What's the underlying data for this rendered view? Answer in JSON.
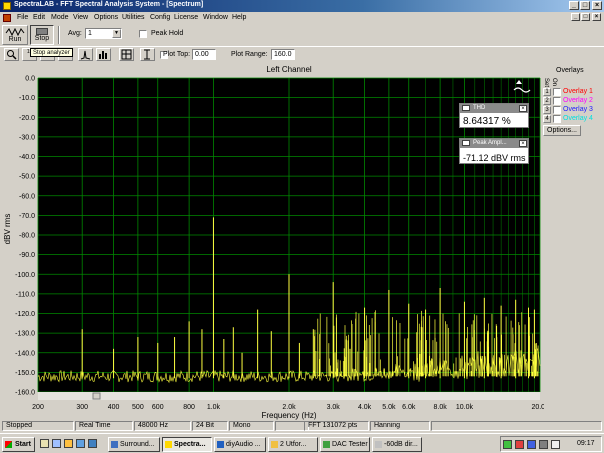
{
  "window": {
    "title": "SpectraLAB - FFT Spectral Analysis System - [Spectrum]"
  },
  "menu": [
    "File",
    "Edit",
    "Mode",
    "View",
    "Options",
    "Utilities",
    "Config",
    "License",
    "Window",
    "Help"
  ],
  "toolbar": {
    "run_label": "Run",
    "stop_label": "Stop",
    "avg_label": "Avg:",
    "avg_value": "1",
    "peak_hold_label": "Peak Hold",
    "tooltip": "Stop analyzer",
    "plot_top_label": "Plot Top:",
    "plot_top_value": "0.00",
    "plot_range_label": "Plot Range:",
    "plot_range_value": "160.0"
  },
  "overlays": {
    "title": "Overlays",
    "set_label": "Set",
    "on_label": "On",
    "items": [
      {
        "num": "1",
        "label": "Overlay 1",
        "color": "#ff0000"
      },
      {
        "num": "2",
        "label": "Overlay 2",
        "color": "#ff00ff"
      },
      {
        "num": "3",
        "label": "Overlay 3",
        "color": "#2020ff"
      },
      {
        "num": "4",
        "label": "Overlay 4",
        "color": "#00e0e0"
      }
    ],
    "options_label": "Options..."
  },
  "readouts": {
    "thd_title": "THD",
    "thd_value": "8.64317 %",
    "peak_title": "Peak Ampl...",
    "peak_value": "-71.12 dBV rms"
  },
  "status": {
    "state": "Stopped",
    "mode": "Real Time",
    "rate": "48000 Hz",
    "bits": "24 Bit",
    "channels": "Mono",
    "fft": "FFT 131072 pts",
    "window": "Hanning"
  },
  "taskbar": {
    "start": "Start",
    "tasks": [
      "Surround...",
      "Spectra...",
      "diyAudio ...",
      "2 Utfor...",
      "DAC Tester",
      "-60dB dir..."
    ],
    "clock": "09:17"
  },
  "colors": {
    "plot_bg": "#000000",
    "grid": "#008800",
    "trace": "#ffff40",
    "title_bar": "#0a246a"
  },
  "chart_data": {
    "type": "line",
    "title": "Left Channel",
    "xlabel": "Frequency (Hz)",
    "ylabel": "dBV rms",
    "x_scale": "log",
    "xlim": [
      200,
      20000
    ],
    "ylim": [
      -160,
      0
    ],
    "grid": true,
    "x_ticks": [
      {
        "v": 200,
        "label": "200"
      },
      {
        "v": 300,
        "label": "300"
      },
      {
        "v": 400,
        "label": "400"
      },
      {
        "v": 500,
        "label": "500"
      },
      {
        "v": 600,
        "label": "600"
      },
      {
        "v": 800,
        "label": "800"
      },
      {
        "v": 1000,
        "label": "1.0k"
      },
      {
        "v": 2000,
        "label": "2.0k"
      },
      {
        "v": 3000,
        "label": "3.0k"
      },
      {
        "v": 4000,
        "label": "4.0k"
      },
      {
        "v": 5000,
        "label": "5.0k"
      },
      {
        "v": 6000,
        "label": "6.0k"
      },
      {
        "v": 8000,
        "label": "8.0k"
      },
      {
        "v": 10000,
        "label": "10.0k"
      },
      {
        "v": 20000,
        "label": "20.0k"
      }
    ],
    "y_ticks": [
      0,
      -10,
      -20,
      -30,
      -40,
      -50,
      -60,
      -70,
      -80,
      -90,
      -100,
      -110,
      -120,
      -130,
      -140,
      -150,
      -160
    ],
    "noise_floor_db": -152,
    "peaks": [
      {
        "f": 1000,
        "db": -71
      },
      {
        "f": 300,
        "db": -128
      },
      {
        "f": 400,
        "db": -138
      },
      {
        "f": 500,
        "db": -132
      },
      {
        "f": 600,
        "db": -135
      },
      {
        "f": 700,
        "db": -132
      },
      {
        "f": 800,
        "db": -124
      },
      {
        "f": 900,
        "db": -128
      },
      {
        "f": 1100,
        "db": -133
      },
      {
        "f": 1200,
        "db": -127
      },
      {
        "f": 1300,
        "db": -140
      },
      {
        "f": 1500,
        "db": -118
      },
      {
        "f": 1700,
        "db": -129
      },
      {
        "f": 2000,
        "db": -100
      },
      {
        "f": 2200,
        "db": -135
      },
      {
        "f": 2500,
        "db": -128
      },
      {
        "f": 3000,
        "db": -104
      },
      {
        "f": 3500,
        "db": -138
      },
      {
        "f": 4000,
        "db": -117
      },
      {
        "f": 5000,
        "db": -108
      },
      {
        "f": 6000,
        "db": -115
      },
      {
        "f": 7000,
        "db": -118
      },
      {
        "f": 8000,
        "db": -107
      },
      {
        "f": 10000,
        "db": -114
      },
      {
        "f": 12000,
        "db": -112
      },
      {
        "f": 14000,
        "db": -116
      },
      {
        "f": 16000,
        "db": -113
      },
      {
        "f": 18000,
        "db": -117
      },
      {
        "f": 19000,
        "db": -118
      }
    ]
  }
}
